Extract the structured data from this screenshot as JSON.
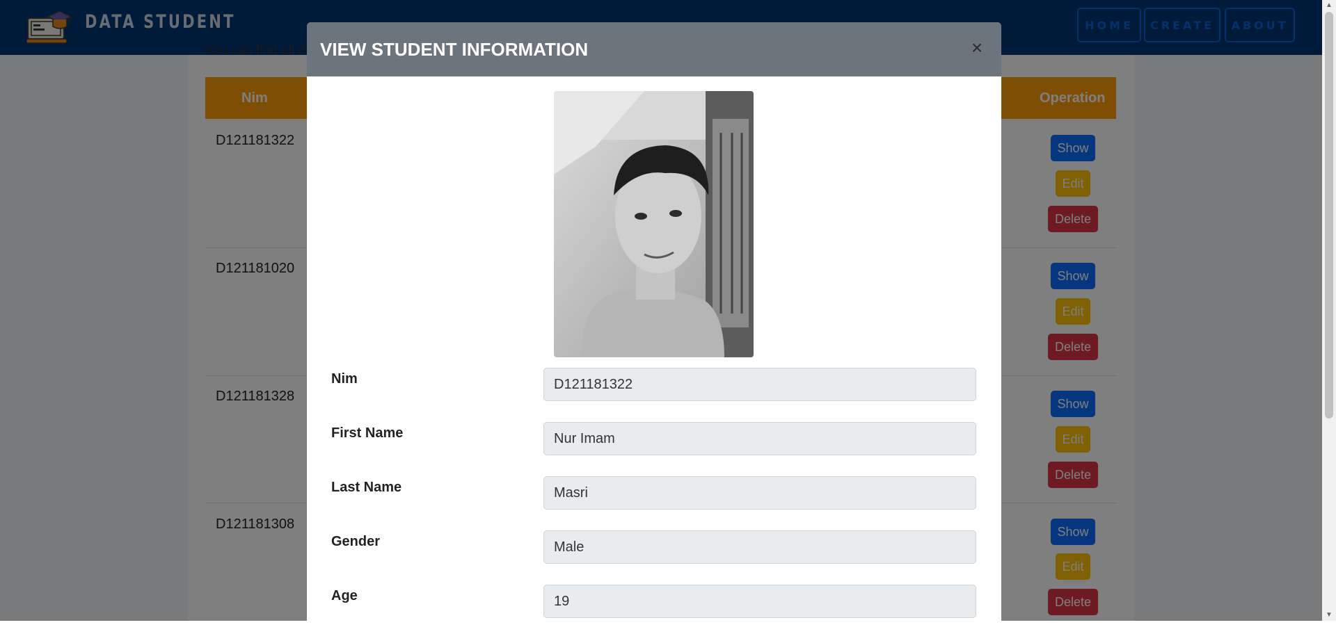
{
  "brand": {
    "name": "DATA STUDENT",
    "logo_icon": "laptop-graduation-cap-icon"
  },
  "nav": [
    {
      "label": "HOME"
    },
    {
      "label": "CREATE"
    },
    {
      "label": "ABOUT"
    }
  ],
  "page": {
    "intro_text": "You can find all d"
  },
  "table": {
    "headers": {
      "nim": "Nim",
      "operation": "Operation"
    },
    "rows": [
      {
        "nim": "D121181322"
      },
      {
        "nim": "D121181020"
      },
      {
        "nim": "D121181328"
      },
      {
        "nim": "D121181308"
      }
    ],
    "buttons": {
      "show": "Show",
      "edit": "Edit",
      "delete": "Delete"
    }
  },
  "modal": {
    "title": "VIEW STUDENT INFORMATION",
    "close_symbol": "×",
    "photo_alt": "student-photo",
    "fields": [
      {
        "label": "Nim",
        "value": "D121181322"
      },
      {
        "label": "First Name",
        "value": "Nur Imam"
      },
      {
        "label": "Last Name",
        "value": "Masri"
      },
      {
        "label": "Gender",
        "value": "Male"
      },
      {
        "label": "Age",
        "value": "19"
      }
    ]
  },
  "colors": {
    "navbar": "#003773",
    "table_header": "#fb9c06",
    "show": "#0d6efd",
    "edit": "#ffc107",
    "delete": "#dc3545",
    "modal_header": "#6c757d"
  }
}
